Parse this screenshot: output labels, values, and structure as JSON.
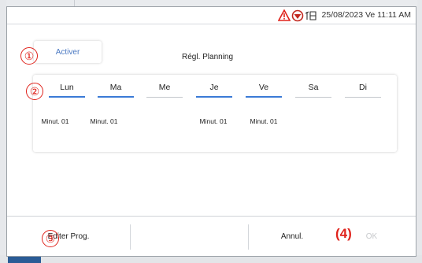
{
  "status_bar": {
    "datetime": "25/08/2023 Ve 11:11 AM",
    "icons": [
      "warning-triangle-icon",
      "maintenance-valve-icon",
      "hour-count-icon"
    ]
  },
  "colors": {
    "accent_blue": "#3b7ad6",
    "annotation_red": "#e0231c",
    "disabled_gray": "#c7c9cc",
    "bottom_accent": "#2a5c96"
  },
  "planning": {
    "activate_label": "Activer",
    "title": "Régl. Planning"
  },
  "days": [
    {
      "label": "Lun",
      "selected": true,
      "timer": "Minut. 01"
    },
    {
      "label": "Ma",
      "selected": true,
      "timer": "Minut. 01"
    },
    {
      "label": "Me",
      "selected": false,
      "timer": ""
    },
    {
      "label": "Je",
      "selected": true,
      "timer": "Minut. 01"
    },
    {
      "label": "Ve",
      "selected": true,
      "timer": "Minut. 01"
    },
    {
      "label": "Sa",
      "selected": false,
      "timer": ""
    },
    {
      "label": "Di",
      "selected": false,
      "timer": ""
    }
  ],
  "actions": {
    "edit_label": "Editer Prog.",
    "cancel_label": "Annul.",
    "ok_label": "OK"
  },
  "callouts": {
    "c1": "①",
    "c2": "②",
    "c3": "③",
    "c4": "(4)"
  }
}
